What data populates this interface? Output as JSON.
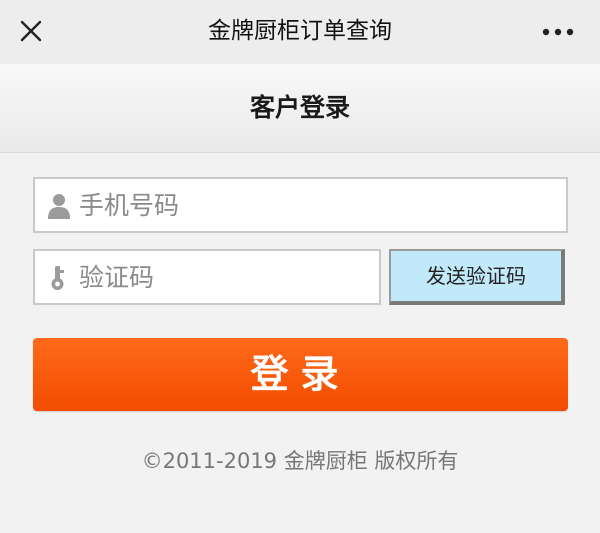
{
  "topbar": {
    "title": "金牌厨柜订单查询",
    "close_icon": "close-icon",
    "more_icon": "more-icon"
  },
  "header": {
    "title": "客户登录"
  },
  "form": {
    "phone": {
      "placeholder": "手机号码",
      "value": "",
      "icon": "user-icon"
    },
    "code": {
      "placeholder": "验证码",
      "value": "",
      "icon": "key-icon"
    },
    "send_code_label": "发送验证码",
    "login_label": "登录"
  },
  "footer": {
    "copyright": "©2011-2019 金牌厨柜 版权所有"
  },
  "colors": {
    "login_button": "#f65a0a",
    "send_code_button": "#c2e9fa",
    "background": "#f2f2f2"
  }
}
